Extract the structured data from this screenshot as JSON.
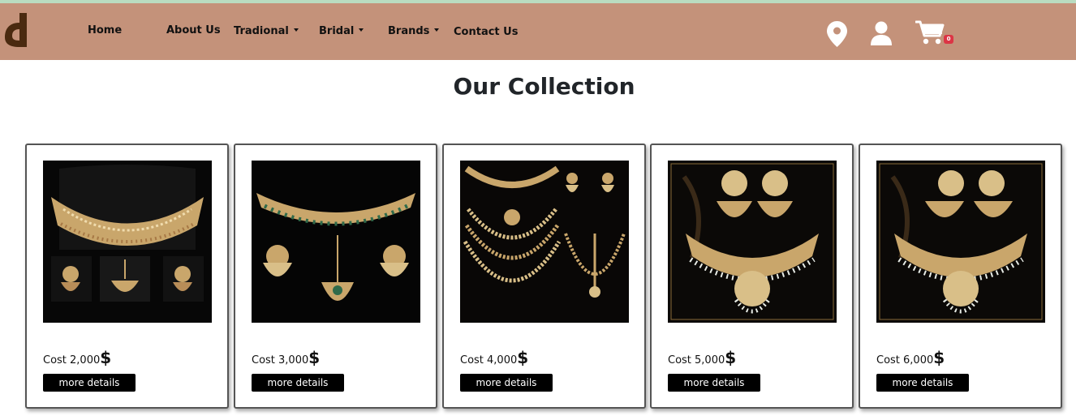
{
  "nav": {
    "items": [
      {
        "label": "Home",
        "dropdown": false
      },
      {
        "label": "About Us",
        "dropdown": false
      },
      {
        "label": "Tradional",
        "dropdown": true
      },
      {
        "label": "Bridal",
        "dropdown": true
      },
      {
        "label": "Brands",
        "dropdown": true
      },
      {
        "label": "Contact Us",
        "dropdown": false
      }
    ],
    "icons": [
      "location-pin-icon",
      "user-icon",
      "cart-icon"
    ],
    "cart_count": "0"
  },
  "page_title": "Our Collection",
  "products": [
    {
      "cost_label": "Cost 2,000",
      "currency": "$",
      "button": "more details",
      "image": "kundan-choker-set"
    },
    {
      "cost_label": "Cost 3,000",
      "currency": "$",
      "button": "more details",
      "image": "kundan-choker-emerald-set"
    },
    {
      "cost_label": "Cost 4,000",
      "currency": "$",
      "button": "more details",
      "image": "layered-rani-haar-set"
    },
    {
      "cost_label": "Cost 5,000",
      "currency": "$",
      "button": "more details",
      "image": "pearl-drop-necklace-set"
    },
    {
      "cost_label": "Cost 6,000",
      "currency": "$",
      "button": "more details",
      "image": "pearl-drop-necklace-set-2"
    }
  ],
  "colors": {
    "navbar": "#c4927a",
    "top_strip": "#b9dcc0",
    "badge": "#dc3545",
    "button": "#000000",
    "logo": "#4a2a10",
    "gold": "#c9a66b"
  }
}
